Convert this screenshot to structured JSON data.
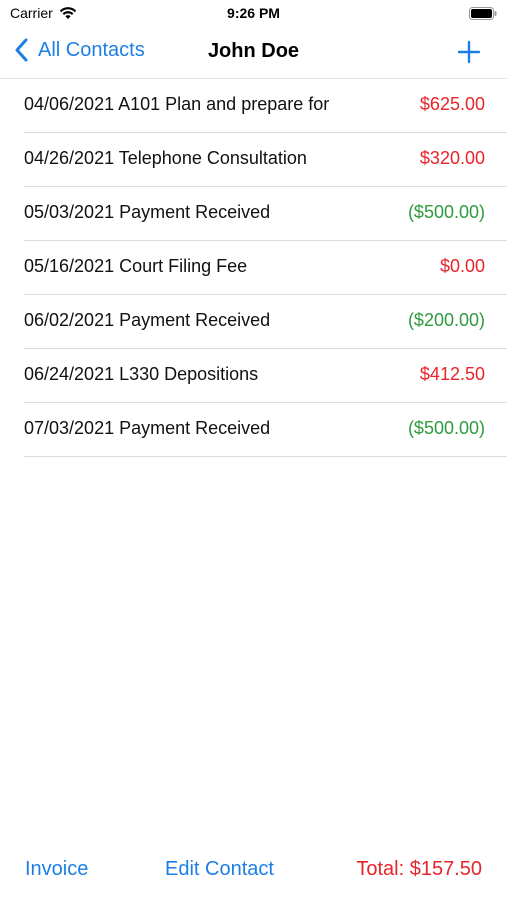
{
  "status_bar": {
    "carrier": "Carrier",
    "time": "9:26 PM",
    "icons": [
      "wifi-icon",
      "battery-icon"
    ]
  },
  "nav": {
    "back_label": "All Contacts",
    "title": "John Doe",
    "add_icon": "plus-icon"
  },
  "colors": {
    "accent": "#1d7fe6",
    "charge": "#e8242b",
    "payment": "#2f9a3f"
  },
  "entries": [
    {
      "text": "04/06/2021 A101 Plan and prepare for",
      "amount": "$625.00",
      "kind": "charge"
    },
    {
      "text": "04/26/2021 Telephone Consultation",
      "amount": "$320.00",
      "kind": "charge"
    },
    {
      "text": "05/03/2021 Payment Received",
      "amount": "($500.00)",
      "kind": "payment"
    },
    {
      "text": "05/16/2021 Court Filing Fee",
      "amount": "$0.00",
      "kind": "charge"
    },
    {
      "text": "06/02/2021 Payment Received",
      "amount": "($200.00)",
      "kind": "payment"
    },
    {
      "text": "06/24/2021 L330 Depositions",
      "amount": "$412.50",
      "kind": "charge"
    },
    {
      "text": "07/03/2021 Payment Received",
      "amount": "($500.00)",
      "kind": "payment"
    }
  ],
  "toolbar": {
    "invoice_label": "Invoice",
    "edit_label": "Edit Contact",
    "total_label": "Total: $157.50"
  }
}
